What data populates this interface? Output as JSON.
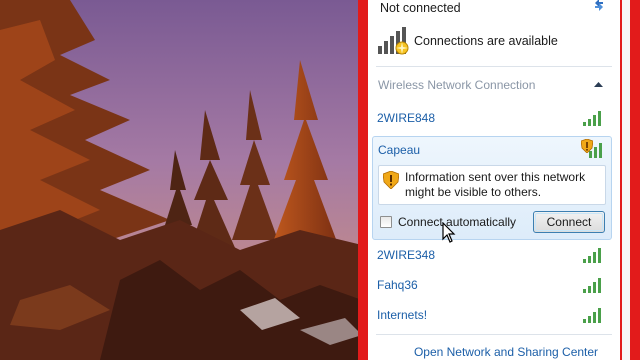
{
  "panel": {
    "status_text": "Not connected",
    "availability_text": "Connections are available",
    "section_title": "Wireless Network Connection",
    "footer_link": "Open Network and Sharing Center"
  },
  "networks": [
    {
      "name": "2WIRE848",
      "secured": true
    },
    {
      "name": "Capeau",
      "secured": false,
      "selected": true
    },
    {
      "name": "2WIRE348",
      "secured": true
    },
    {
      "name": "Fahq36",
      "secured": true
    },
    {
      "name": "Internets!",
      "secured": true
    }
  ],
  "selected_network": {
    "warning": "Information sent over this network might be visible to others.",
    "checkbox_label": "Connect automatically",
    "checkbox_checked": false,
    "connect_label": "Connect"
  },
  "colors": {
    "frame_red": "#e21b1b",
    "link_blue": "#1c5fa8",
    "selection_bg": "#ddecfa"
  },
  "icons": {
    "refresh": "refresh-icon",
    "availability": "network-available-icon",
    "collapse": "chevron-up-icon",
    "signal": "signal-strength-icon",
    "warning": "security-warning-icon"
  }
}
